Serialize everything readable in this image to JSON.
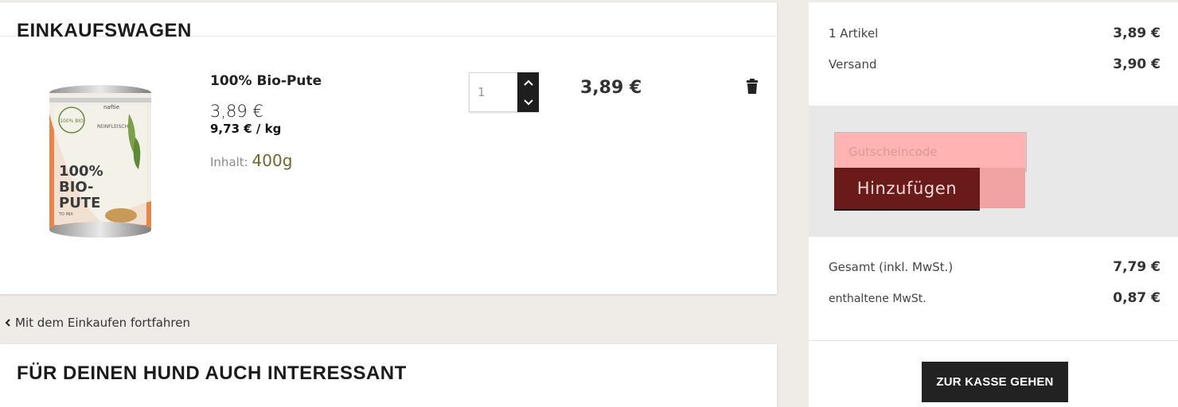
{
  "cart": {
    "title": "EINKAUFSWAGEN",
    "item": {
      "name": "100% Bio-Pute",
      "price": "3,89 €",
      "unit_price": "9,73 € / kg",
      "content_label": "Inhalt:",
      "content_value": "400g",
      "quantity": "1",
      "line_total": "3,89 €",
      "image_icon": "product-can-image",
      "image_text": {
        "brand": "naftie",
        "badge": "100% BIO",
        "subtitle": "REINFLEISCH",
        "line1": "100%",
        "line2": "BIO-",
        "line3": "PUTE",
        "line4": "TO MIX"
      }
    },
    "continue_label": "Mit dem Einkaufen fortfahren"
  },
  "recommendations": {
    "title": "FÜR DEINEN HUND AUCH INTERESSANT"
  },
  "summary": {
    "items_label": "1 Artikel",
    "items_value": "3,89 €",
    "shipping_label": "Versand",
    "shipping_value": "3,90 €",
    "coupon_placeholder": "Gutscheincode",
    "coupon_button": "Hinzufügen",
    "total_label": "Gesamt (inkl. MwSt.)",
    "total_value": "7,79 €",
    "vat_label": "enthaltene MwSt.",
    "vat_value": "0,87 €",
    "checkout_button": "ZUR KASSE GEHEN"
  },
  "colors": {
    "page_bg": "#efece8",
    "coupon_button": "#6b1a1a",
    "coupon_input": "#ffb3b3",
    "checkout_button": "#222222",
    "content_value": "#6b6a2a"
  }
}
